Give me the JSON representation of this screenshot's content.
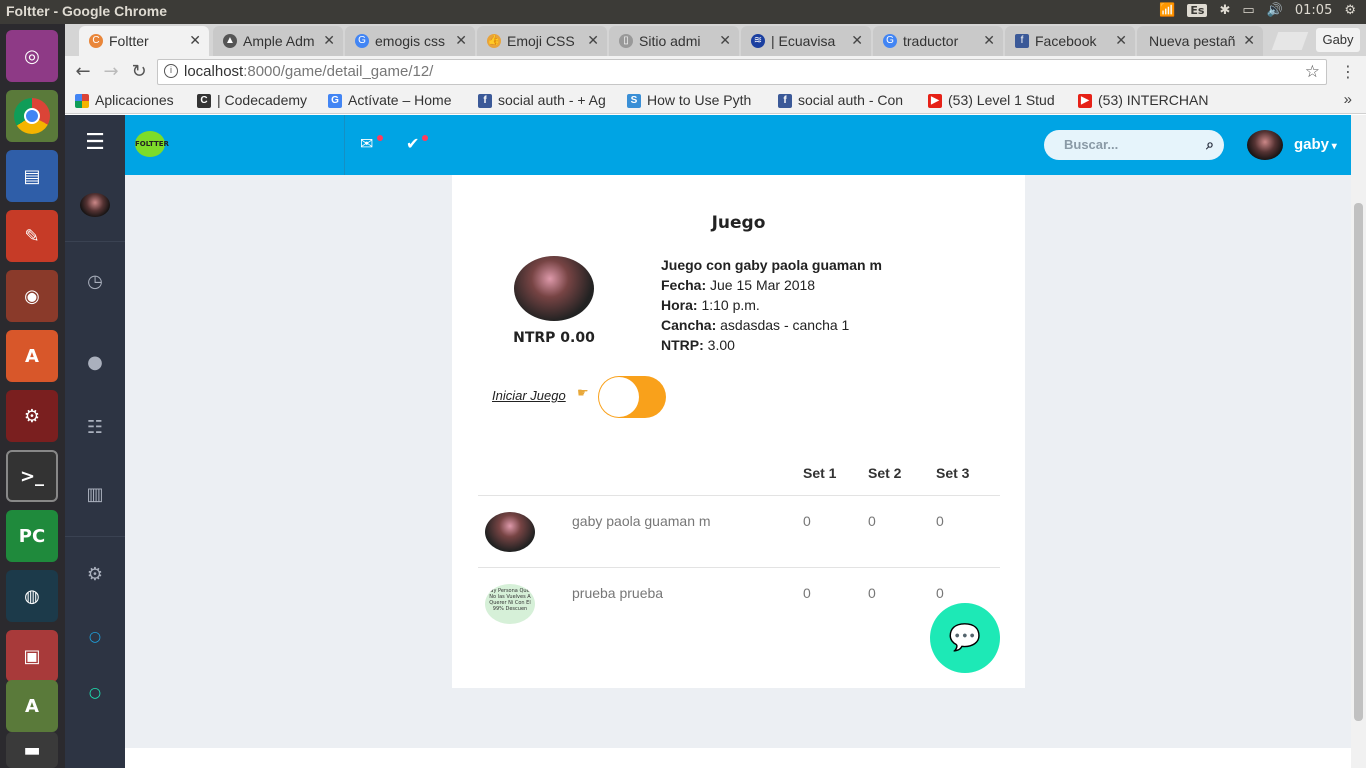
{
  "os": {
    "window_title": "Foltter - Google Chrome",
    "keyboard": "Es",
    "clock": "01:05",
    "user": "Gaby"
  },
  "tabs": [
    {
      "label": "Foltter",
      "active": true
    },
    {
      "label": "Ample Adm"
    },
    {
      "label": "emogis css"
    },
    {
      "label": "Emoji CSS"
    },
    {
      "label": "Sitio admi"
    },
    {
      "label": "| Ecuavisa"
    },
    {
      "label": "traductor"
    },
    {
      "label": "Facebook"
    },
    {
      "label": "Nueva pestañ"
    }
  ],
  "profile_button": "Gaby",
  "address": {
    "host": "localhost",
    "path": ":8000/game/detail_game/12/"
  },
  "bookmarks": [
    {
      "label": "Aplicaciones"
    },
    {
      "label": "| Codecademy"
    },
    {
      "label": "Actívate – Home"
    },
    {
      "label": "social auth - + Ag"
    },
    {
      "label": "How to Use Pyth"
    },
    {
      "label": "social auth - Con"
    },
    {
      "label": "(53) Level 1 Stud"
    },
    {
      "label": "(53) INTERCHAN"
    }
  ],
  "app": {
    "logo_text": "FOLTTER",
    "search_placeholder": "Buscar...",
    "user_name": "gaby"
  },
  "game": {
    "title": "Juego",
    "player_ntrp": "NTRP 0.00",
    "heading": "Juego con gaby paola guaman m",
    "fecha_label": "Fecha:",
    "fecha_value": "Jue 15 Mar 2018",
    "hora_label": "Hora:",
    "hora_value": "1:10 p.m.",
    "cancha_label": "Cancha:",
    "cancha_value": "asdasdas - cancha 1",
    "ntrp_label": "NTRP:",
    "ntrp_value": "3.00",
    "start_label": "Iniciar Juego",
    "toggle_on": true
  },
  "table": {
    "headers": [
      "Set 1",
      "Set 2",
      "Set 3"
    ],
    "rows": [
      {
        "name": "gaby paola guaman m",
        "sets": [
          "0",
          "0",
          "0"
        ]
      },
      {
        "name": "prueba prueba",
        "sets": [
          "0",
          "0",
          "0"
        ],
        "avatar_text": "ay Persona Que No las Vuelves A Querer Ni Con El 99% Descuen"
      }
    ]
  },
  "colors": {
    "header": "#00a4e4",
    "sidenav": "#2d3443",
    "toggle": "#f9a11b",
    "fab": "#1de9b6"
  }
}
